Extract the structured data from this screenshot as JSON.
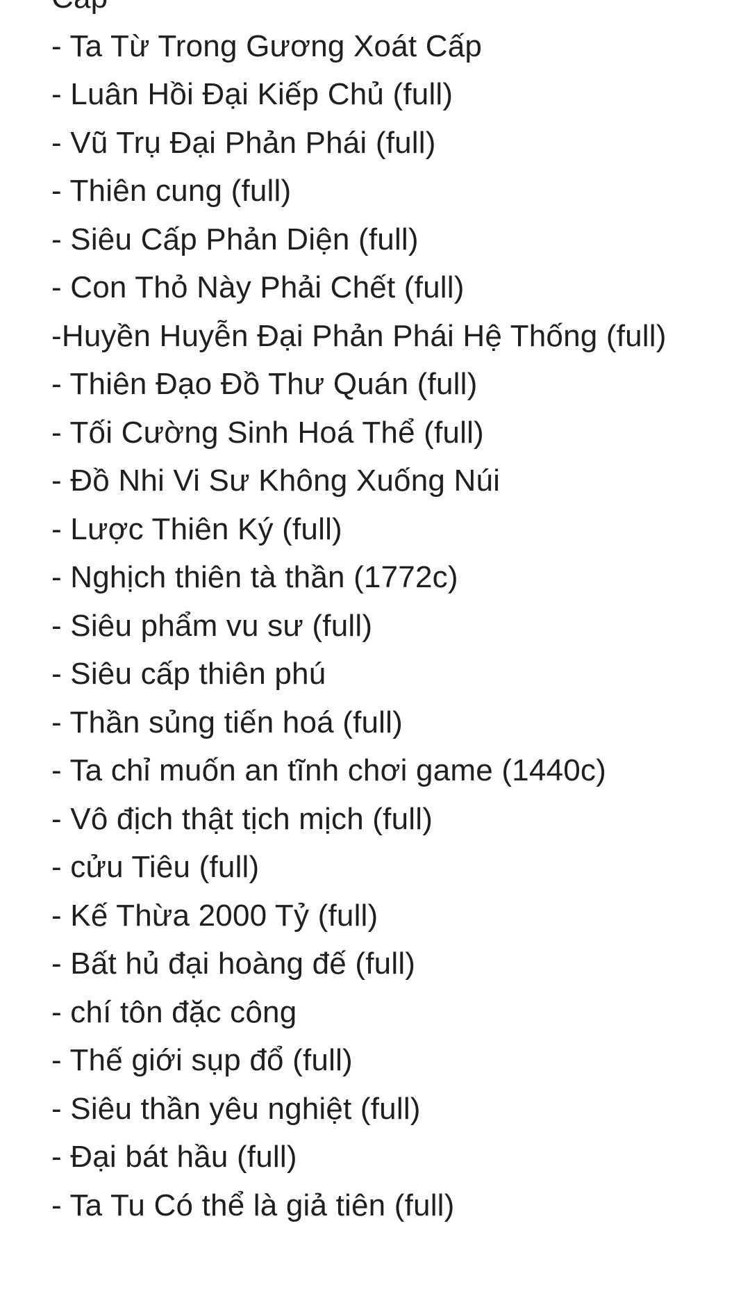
{
  "note": {
    "lines": [
      "Cấp",
      "- Ta Từ Trong Gương Xoát Cấp",
      "- Luân Hồi Đại Kiếp Chủ (full)",
      "- Vũ Trụ Đại Phản Phái (full)",
      "- Thiên cung (full)",
      "- Siêu Cấp Phản Diện (full)",
      "- Con Thỏ Này Phải Chết (full)",
      "-Huyền Huyễn Đại Phản Phái Hệ Thống (full)",
      "- Thiên Đạo Đồ Thư Quán  (full)",
      "- Tối Cường Sinh Hoá Thể (full)",
      "- Đồ Nhi Vi Sư Không Xuống Núi",
      "- Lược Thiên Ký (full)",
      "- Nghịch thiên tà thần (1772c)",
      "- Siêu phẩm vu sư (full)",
      "- Siêu cấp thiên phú",
      "- Thần sủng tiến hoá (full)",
      "- Ta chỉ muốn an tĩnh chơi game (1440c)",
      "- Vô địch thật tịch mịch (full)",
      "- cửu Tiêu (full)",
      "- Kế Thừa 2000 Tỷ (full)",
      "- Bất hủ đại hoàng đế (full)",
      "- chí tôn đặc công",
      "- Thế giới sụp đổ (full)",
      "- Siêu thần yêu nghiệt (full)",
      "- Đại bát hầu (full)",
      "- Ta Tu Có thể là giả tiên (full)"
    ]
  }
}
